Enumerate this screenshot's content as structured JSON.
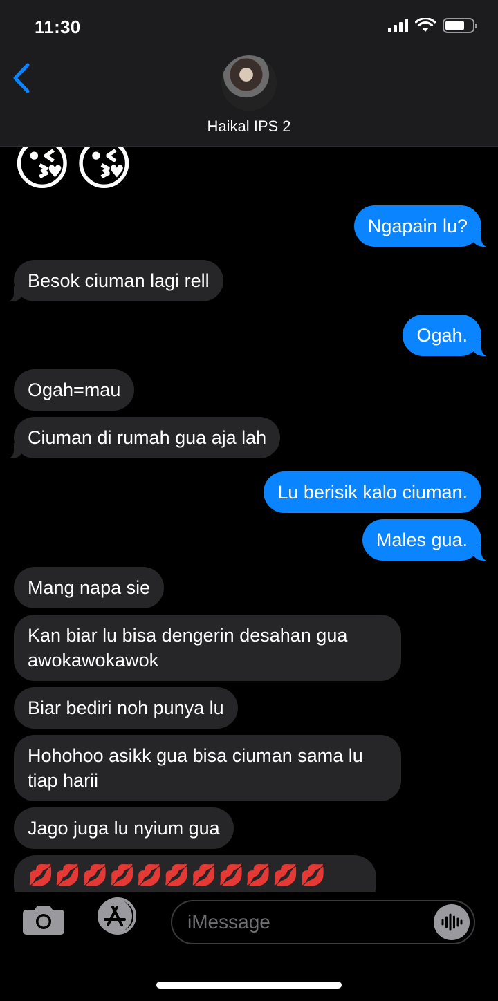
{
  "status_bar": {
    "time": "11:30"
  },
  "header": {
    "contact_name": "Haikal IPS 2"
  },
  "messages": {
    "top_emojis": [
      "😘",
      "😘"
    ],
    "items": [
      {
        "side": "out",
        "text": "Ngapain lu?"
      },
      {
        "side": "in",
        "text": "Besok ciuman lagi rell"
      },
      {
        "side": "out",
        "text": "Ogah."
      },
      {
        "side": "in",
        "text": "Ogah=mau"
      },
      {
        "side": "in",
        "text": "Ciuman di rumah gua aja lah"
      },
      {
        "side": "out",
        "text": "Lu berisik kalo ciuman."
      },
      {
        "side": "out",
        "text": "Males gua."
      },
      {
        "side": "in",
        "text": "Mang napa sie"
      },
      {
        "side": "in",
        "text": "Kan biar lu bisa dengerin desahan gua awokawokawok"
      },
      {
        "side": "in",
        "text": "Biar bediri noh punya lu"
      },
      {
        "side": "in",
        "text": "Hohohoo asikk gua bisa ciuman sama lu tiap harii"
      },
      {
        "side": "in",
        "text": "Jago juga lu nyium gua"
      },
      {
        "side": "in",
        "text": "💋💋💋💋💋💋💋💋💋💋💋"
      }
    ]
  },
  "input_bar": {
    "placeholder": "iMessage"
  },
  "colors": {
    "outgoing": "#0a84ff",
    "incoming": "#262628",
    "accent": "#0a84ff"
  },
  "icons": [
    "back-chevron-icon",
    "camera-icon",
    "app-store-icon",
    "audio-waveform-icon",
    "signal-icon",
    "wifi-icon",
    "battery-icon"
  ]
}
